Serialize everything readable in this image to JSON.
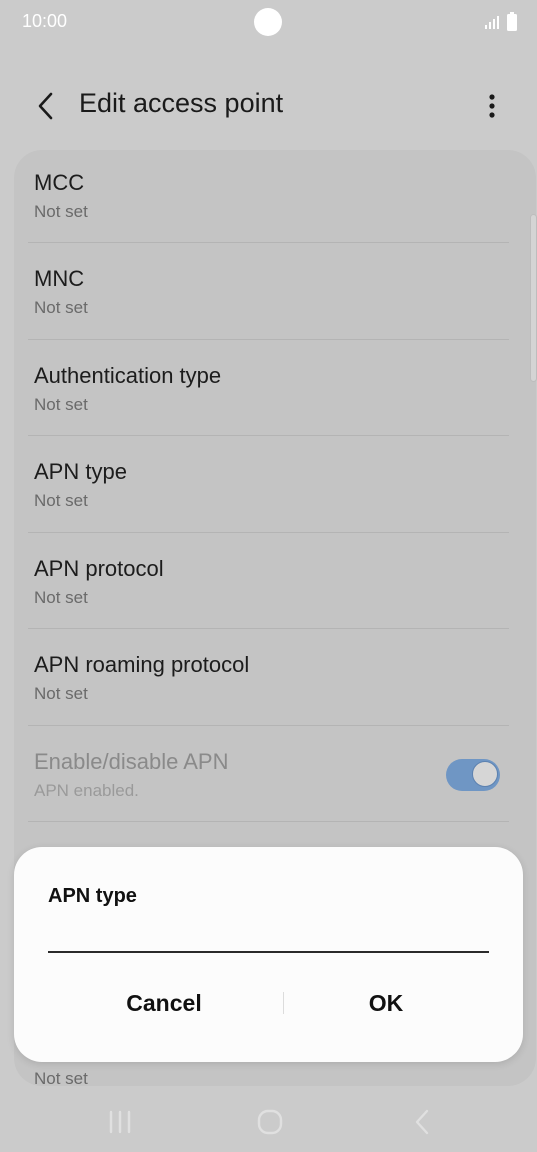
{
  "status_bar": {
    "time": "10:00"
  },
  "app_bar": {
    "title": "Edit access point"
  },
  "settings": [
    {
      "title": "MCC",
      "value": "Not set"
    },
    {
      "title": "MNC",
      "value": "Not set"
    },
    {
      "title": "Authentication type",
      "value": "Not set"
    },
    {
      "title": "APN type",
      "value": "Not set"
    },
    {
      "title": "APN protocol",
      "value": "Not set"
    },
    {
      "title": "APN roaming protocol",
      "value": "Not set"
    },
    {
      "title": "Enable/disable APN",
      "value": "APN enabled.",
      "toggle_on": true
    }
  ],
  "bottom_row_value": "Not set",
  "dialog": {
    "title": "APN type",
    "input_value": "",
    "cancel_label": "Cancel",
    "ok_label": "OK"
  },
  "colors": {
    "toggle_on": "#6f96c4",
    "scrim": "#cbcbcb",
    "dialog": "#fcfcfc"
  }
}
